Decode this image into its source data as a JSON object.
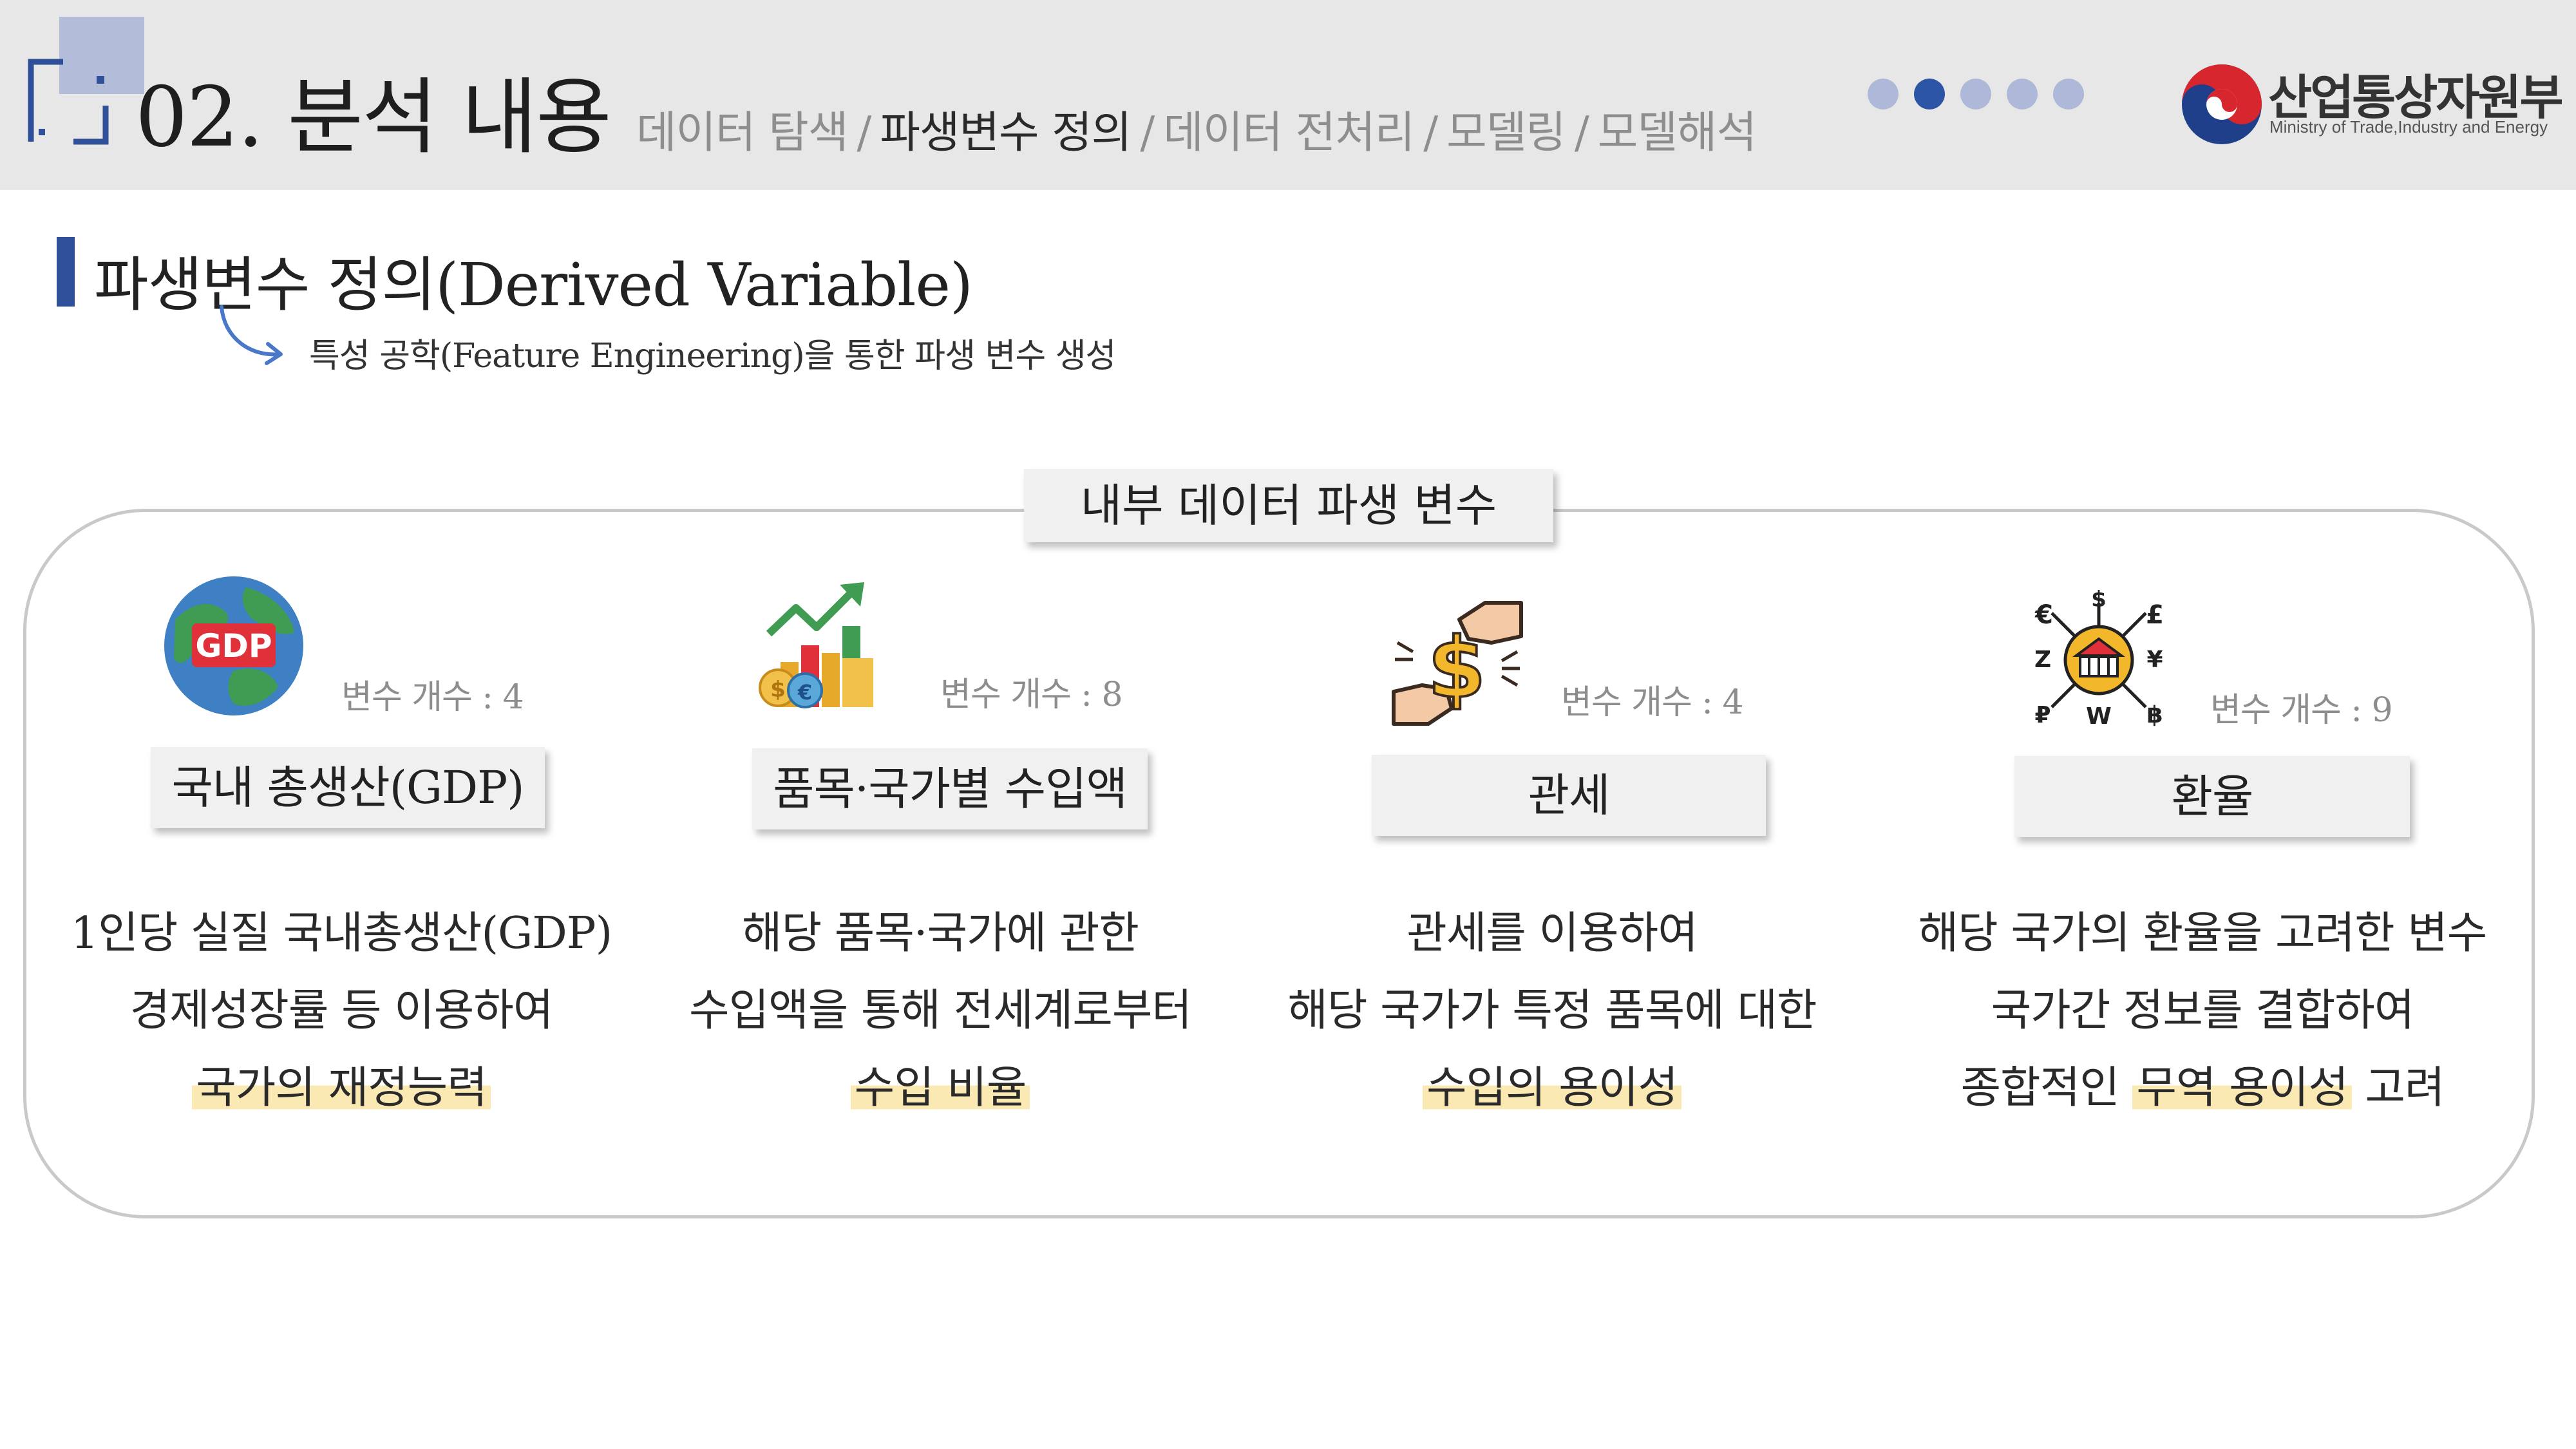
{
  "header": {
    "section_title": "02. 분석 내용",
    "breadcrumb": [
      "데이터 탐색",
      "파생변수 정의",
      "데이터 전처리",
      "모델링",
      "모델해석"
    ],
    "breadcrumb_separator": "/",
    "active_breadcrumb": "파생변수 정의",
    "pager": {
      "total": 5,
      "current": 2
    },
    "logo": {
      "name": "산업통상자원부",
      "sub": "Ministry of Trade,Industry and Energy"
    }
  },
  "subheading": {
    "title": "파생변수 정의(Derived Variable)",
    "caption": "특성 공학(Feature Engineering)을 통한 파생 변수 생성"
  },
  "panel": {
    "title": "내부 데이터 파생 변수",
    "items": [
      {
        "icon": "gdp-globe-icon",
        "count": "변수 개수 : 4",
        "label": "국내 총생산(GDP)",
        "lines": [
          "1인당 실질 국내총생산(GDP)",
          "경제성장률 등 이용하여"
        ],
        "highlight_pre": "",
        "highlight": "국가의 재정능력",
        "highlight_post": ""
      },
      {
        "icon": "growth-chart-coins-icon",
        "count": "변수 개수 : 8",
        "label": "품목·국가별 수입액",
        "lines": [
          "해당 품목·국가에 관한",
          "수입액을 통해 전세계로부터"
        ],
        "highlight_pre": "",
        "highlight": "수입 비율",
        "highlight_post": ""
      },
      {
        "icon": "money-exchange-hands-icon",
        "count": "변수 개수 : 4",
        "label": "관세",
        "lines": [
          "관세를 이용하여",
          "해당 국가가 특정 품목에 대한"
        ],
        "highlight_pre": "",
        "highlight": "수입의 용이성",
        "highlight_post": ""
      },
      {
        "icon": "currency-bank-icon",
        "count": "변수 개수 : 9",
        "label": "환율",
        "lines": [
          "해당 국가의 환율을 고려한 변수",
          "국가간 정보를 결합하여"
        ],
        "highlight_pre": "종합적인 ",
        "highlight": "무역 용이성",
        "highlight_post": " 고려"
      }
    ]
  },
  "colors": {
    "accent_blue": "#2f4f98",
    "active_dot": "#2d55a6",
    "inactive_dot": "#aeb8d8",
    "highlight": "#fbe9b4",
    "header_bg": "#e7e7e7"
  }
}
